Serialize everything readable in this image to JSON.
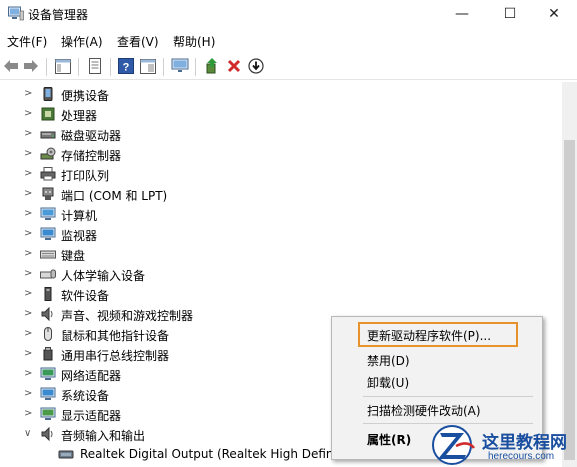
{
  "window": {
    "title": "设备管理器",
    "controls": [
      "—",
      "☐",
      "✕"
    ]
  },
  "menu": [
    "文件(F)",
    "操作(A)",
    "查看(V)",
    "帮助(H)"
  ],
  "tree": {
    "items": [
      {
        "label": "便携设备",
        "icon": "portable-device-icon",
        "expanded": false
      },
      {
        "label": "处理器",
        "icon": "cpu-icon",
        "expanded": false
      },
      {
        "label": "磁盘驱动器",
        "icon": "disk-drive-icon",
        "expanded": false
      },
      {
        "label": "存储控制器",
        "icon": "storage-controller-icon",
        "expanded": false
      },
      {
        "label": "打印队列",
        "icon": "printer-icon",
        "expanded": false
      },
      {
        "label": "端口 (COM 和 LPT)",
        "icon": "port-icon",
        "expanded": false
      },
      {
        "label": "计算机",
        "icon": "computer-icon",
        "expanded": false
      },
      {
        "label": "监视器",
        "icon": "monitor-icon",
        "expanded": false
      },
      {
        "label": "键盘",
        "icon": "keyboard-icon",
        "expanded": false
      },
      {
        "label": "人体学输入设备",
        "icon": "hid-icon",
        "expanded": false
      },
      {
        "label": "软件设备",
        "icon": "software-device-icon",
        "expanded": false
      },
      {
        "label": "声音、视频和游戏控制器",
        "icon": "sound-icon",
        "expanded": false
      },
      {
        "label": "鼠标和其他指针设备",
        "icon": "mouse-icon",
        "expanded": false
      },
      {
        "label": "通用串行总线控制器",
        "icon": "usb-icon",
        "expanded": false
      },
      {
        "label": "网络适配器",
        "icon": "network-icon",
        "expanded": false
      },
      {
        "label": "系统设备",
        "icon": "system-device-icon",
        "expanded": false
      },
      {
        "label": "显示适配器",
        "icon": "display-adapter-icon",
        "expanded": false
      },
      {
        "label": "音频输入和输出",
        "icon": "audio-icon",
        "expanded": true
      }
    ],
    "child": {
      "label": "Realtek Digital Output (Realtek High Definition Audio)",
      "icon": "speaker-device-icon"
    }
  },
  "context_menu": {
    "items": [
      "更新驱动程序软件(P)...",
      "禁用(D)",
      "卸载(U)",
      "扫描检测硬件改动(A)",
      "属性(R)"
    ],
    "highlight_color": "#e8922b"
  },
  "watermark": {
    "main": "这里教程网",
    "sub": "herecours.com",
    "color": "#1a4fa0"
  }
}
